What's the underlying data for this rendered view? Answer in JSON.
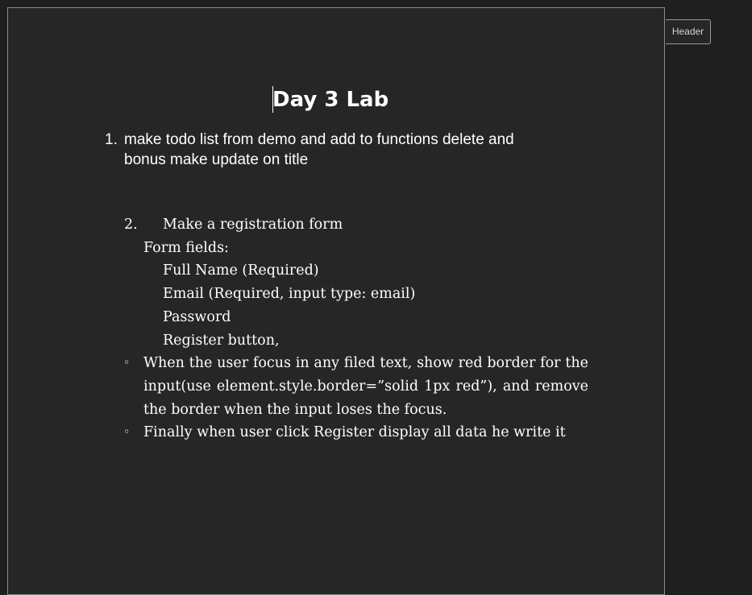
{
  "header_label": "Header",
  "title": "Day 3 Lab",
  "item1": {
    "number": "1.",
    "line1": "make todo list from demo and add to functions delete and",
    "line2": "bonus make update on title"
  },
  "item2": {
    "number": "2.",
    "heading": "Make a registration form",
    "form_fields_label": "Form fields:",
    "fields": [
      "Full Name (Required)",
      "Email (Required, input type: email)",
      "Password",
      "Register button,"
    ]
  },
  "bullets": [
    "When the user focus in any filed text, show red border for the input(use element.style.border=”solid 1px red”), and remove the border when the input loses the focus.",
    "Finally when user click Register display all data he write it"
  ],
  "bullet_symbol": "◦"
}
